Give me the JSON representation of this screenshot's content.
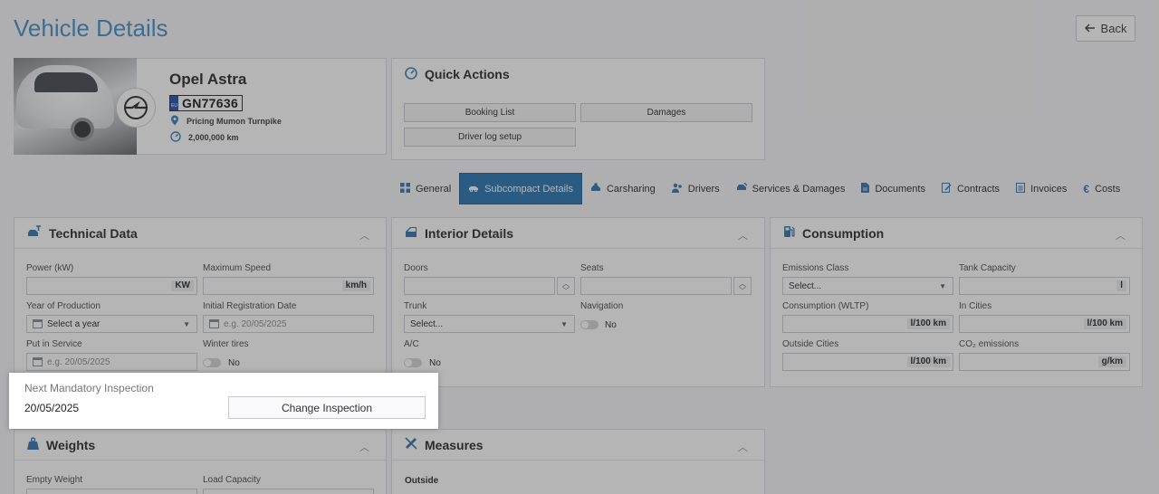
{
  "page": {
    "title": "Vehicle Details",
    "back_label": "Back"
  },
  "vehicle": {
    "name": "Opel Astra",
    "plate": "GN77636",
    "plate_country": "EU",
    "location": "Pricing Mumon Turnpike",
    "mileage": "2,000,000 km"
  },
  "quick_actions": {
    "title": "Quick Actions",
    "buttons": [
      "Booking List",
      "Damages",
      "Driver log setup"
    ]
  },
  "tabs": [
    {
      "label": "General",
      "icon": "grid-icon"
    },
    {
      "label": "Subcompact Details",
      "icon": "car-icon",
      "active": true
    },
    {
      "label": "Carsharing",
      "icon": "carsharing-icon"
    },
    {
      "label": "Drivers",
      "icon": "drivers-icon"
    },
    {
      "label": "Services & Damages",
      "icon": "services-icon"
    },
    {
      "label": "Documents",
      "icon": "document-icon"
    },
    {
      "label": "Contracts",
      "icon": "contract-icon"
    },
    {
      "label": "Invoices",
      "icon": "invoice-icon"
    },
    {
      "label": "Costs",
      "icon": "euro-icon"
    }
  ],
  "technical": {
    "title": "Technical Data",
    "power_label": "Power (kW)",
    "power_unit": "KW",
    "speed_label": "Maximum Speed",
    "speed_unit": "km/h",
    "year_label": "Year of Production",
    "year_placeholder": "Select a year",
    "reg_label": "Initial Registration Date",
    "reg_placeholder": "e.g. 20/05/2025",
    "service_label": "Put in Service",
    "service_placeholder": "e.g. 20/05/2025",
    "winter_label": "Winter tires",
    "winter_value": "No"
  },
  "interior": {
    "title": "Interior Details",
    "doors_label": "Doors",
    "seats_label": "Seats",
    "trunk_label": "Trunk",
    "trunk_placeholder": "Select...",
    "nav_label": "Navigation",
    "nav_value": "No",
    "ac_label": "A/C",
    "ac_value": "No"
  },
  "consumption": {
    "title": "Consumption",
    "emission_class_label": "Emissions Class",
    "emission_class_placeholder": "Select...",
    "tank_label": "Tank Capacity",
    "tank_unit": "l",
    "wltp_label": "Consumption (WLTP)",
    "wltp_unit": "l/100 km",
    "cities_label": "In Cities",
    "cities_unit": "l/100 km",
    "outside_label": "Outside Cities",
    "outside_unit": "l/100 km",
    "co2_label": "CO₂ emissions",
    "co2_unit": "g/km"
  },
  "inspection": {
    "label": "Next Mandatory Inspection",
    "value": "20/05/2025",
    "button": "Change Inspection"
  },
  "weights": {
    "title": "Weights",
    "empty_label": "Empty Weight",
    "load_label": "Load Capacity"
  },
  "measures": {
    "title": "Measures",
    "outside_label": "Outside"
  },
  "colors": {
    "accent": "#1d6fae",
    "title": "#3c8cc7"
  }
}
